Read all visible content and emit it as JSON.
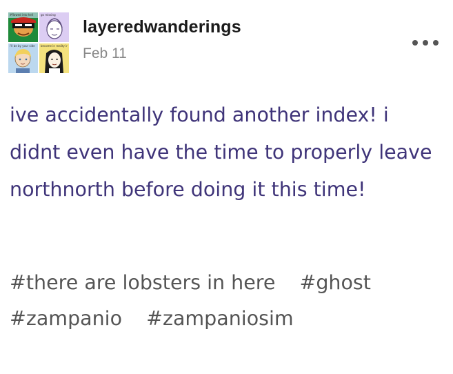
{
  "post": {
    "author": {
      "username": "layeredwanderings",
      "date": "Feb 11",
      "avatar_captions": [
        "#flowed into hell",
        "go missing",
        "i'll be by your side",
        "become in reality into the ..."
      ]
    },
    "more_icon": "more-options-icon",
    "body": "ive accidentally found another index! i didnt even have the time to properly leave northnorth before doing it this time!",
    "tags": [
      "#there are lobsters in here",
      "#ghost",
      "#zampanio",
      "#zampaniosim"
    ]
  },
  "colors": {
    "body_text": "#3f3479",
    "tag_text": "#555555",
    "username": "#1a1a1a",
    "timestamp": "#888888"
  }
}
